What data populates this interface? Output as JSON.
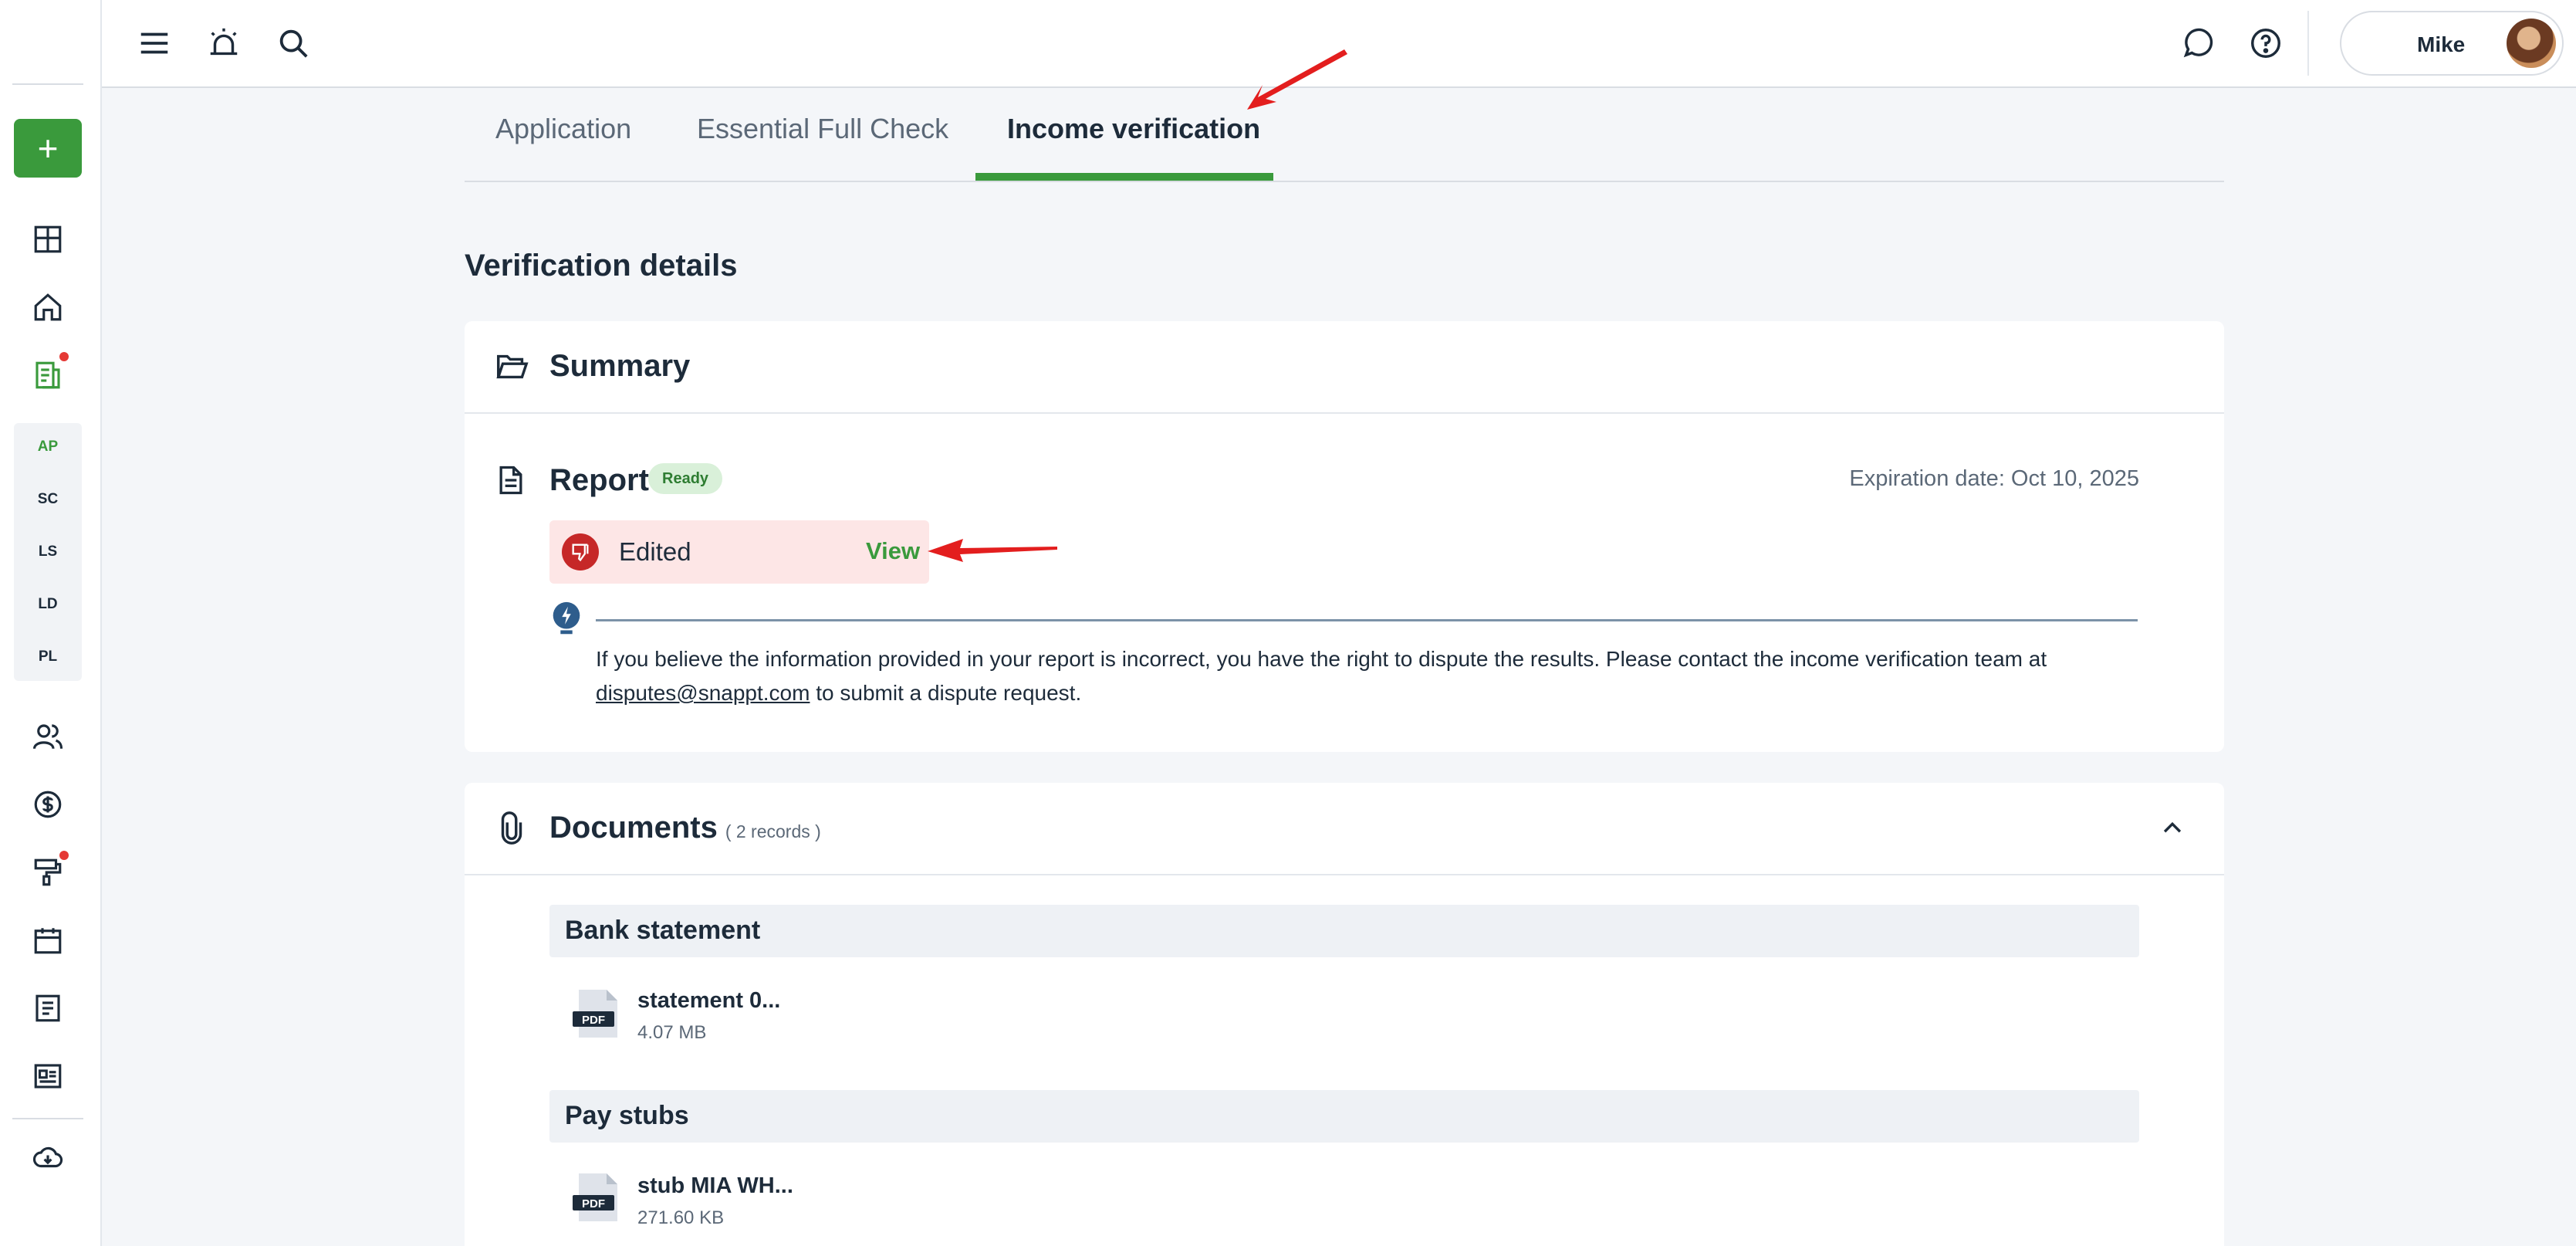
{
  "rail": {
    "add_label": "+",
    "subnav": [
      "AP",
      "SC",
      "LS",
      "LD",
      "PL"
    ],
    "active_subnav": "AP"
  },
  "topbar": {
    "user_name": "Mike"
  },
  "tabs": [
    {
      "label": "Application",
      "active": false
    },
    {
      "label": "Essential Full Check",
      "active": false
    },
    {
      "label": "Income verification",
      "active": true
    }
  ],
  "section_title": "Verification details",
  "summary": {
    "title": "Summary",
    "report_title": "Report",
    "status_badge": "Ready",
    "expiration": "Expiration date: Oct 10, 2025",
    "edited_label": "Edited",
    "view_label": "View",
    "tip_text_before": "If you believe the information provided in your report is incorrect, you have the right to dispute the results. Please contact the income verification team at",
    "tip_email": "disputes@snappt.com",
    "tip_text_after": "to submit a dispute request."
  },
  "documents": {
    "title": "Documents",
    "records": "( 2 records )",
    "groups": [
      {
        "title": "Bank statement",
        "file_name": "statement 0...",
        "file_size": "4.07 MB",
        "file_type": "PDF"
      },
      {
        "title": "Pay stubs",
        "file_name": "stub MIA WH...",
        "file_size": "271.60 KB",
        "file_type": "PDF"
      }
    ]
  },
  "colors": {
    "accent": "#3a9a3c",
    "danger": "#c62828",
    "annotation_arrow": "#e31e1e"
  }
}
